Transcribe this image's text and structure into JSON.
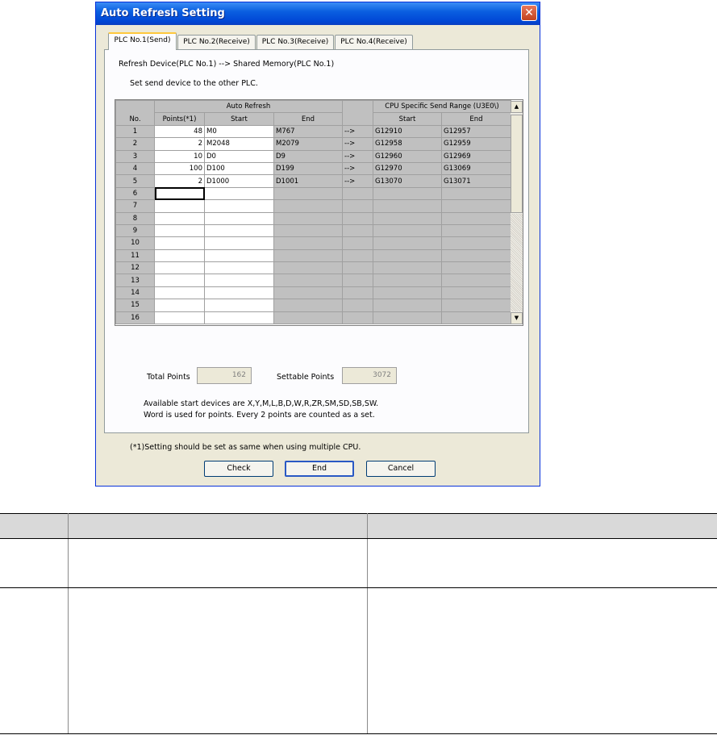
{
  "window": {
    "title": "Auto Refresh Setting",
    "close_glyph": "✕"
  },
  "tabs": [
    {
      "label": "PLC No.1(Send)",
      "active": true
    },
    {
      "label": "PLC No.2(Receive)",
      "active": false
    },
    {
      "label": "PLC No.3(Receive)",
      "active": false
    },
    {
      "label": "PLC No.4(Receive)",
      "active": false
    }
  ],
  "info": {
    "refresh_device": "Refresh Device(PLC No.1) --> Shared Memory(PLC No.1)",
    "instruction": "Set send device to the other PLC."
  },
  "grid": {
    "header_auto_refresh": "Auto Refresh",
    "header_cpu_range": "CPU Specific Send Range (U3E0\\)",
    "col_no": "No.",
    "col_points": "Points(*1)",
    "col_start": "Start",
    "col_end": "End",
    "col_cpu_start": "Start",
    "col_cpu_end": "End",
    "arrow": "-->",
    "rows": [
      {
        "no": "1",
        "points": "48",
        "start": "M0",
        "end": "M767",
        "arrow": "-->",
        "cpu_start": "G12910",
        "cpu_end": "G12957"
      },
      {
        "no": "2",
        "points": "2",
        "start": "M2048",
        "end": "M2079",
        "arrow": "-->",
        "cpu_start": "G12958",
        "cpu_end": "G12959"
      },
      {
        "no": "3",
        "points": "10",
        "start": "D0",
        "end": "D9",
        "arrow": "-->",
        "cpu_start": "G12960",
        "cpu_end": "G12969"
      },
      {
        "no": "4",
        "points": "100",
        "start": "D100",
        "end": "D199",
        "arrow": "-->",
        "cpu_start": "G12970",
        "cpu_end": "G13069"
      },
      {
        "no": "5",
        "points": "2",
        "start": "D1000",
        "end": "D1001",
        "arrow": "-->",
        "cpu_start": "G13070",
        "cpu_end": "G13071"
      },
      {
        "no": "6",
        "points": "",
        "start": "",
        "end": "",
        "arrow": "",
        "cpu_start": "",
        "cpu_end": ""
      },
      {
        "no": "7",
        "points": "",
        "start": "",
        "end": "",
        "arrow": "",
        "cpu_start": "",
        "cpu_end": ""
      },
      {
        "no": "8",
        "points": "",
        "start": "",
        "end": "",
        "arrow": "",
        "cpu_start": "",
        "cpu_end": ""
      },
      {
        "no": "9",
        "points": "",
        "start": "",
        "end": "",
        "arrow": "",
        "cpu_start": "",
        "cpu_end": ""
      },
      {
        "no": "10",
        "points": "",
        "start": "",
        "end": "",
        "arrow": "",
        "cpu_start": "",
        "cpu_end": ""
      },
      {
        "no": "11",
        "points": "",
        "start": "",
        "end": "",
        "arrow": "",
        "cpu_start": "",
        "cpu_end": ""
      },
      {
        "no": "12",
        "points": "",
        "start": "",
        "end": "",
        "arrow": "",
        "cpu_start": "",
        "cpu_end": ""
      },
      {
        "no": "13",
        "points": "",
        "start": "",
        "end": "",
        "arrow": "",
        "cpu_start": "",
        "cpu_end": ""
      },
      {
        "no": "14",
        "points": "",
        "start": "",
        "end": "",
        "arrow": "",
        "cpu_start": "",
        "cpu_end": ""
      },
      {
        "no": "15",
        "points": "",
        "start": "",
        "end": "",
        "arrow": "",
        "cpu_start": "",
        "cpu_end": ""
      },
      {
        "no": "16",
        "points": "",
        "start": "",
        "end": "",
        "arrow": "",
        "cpu_start": "",
        "cpu_end": ""
      }
    ],
    "scroll_up_glyph": "▲",
    "scroll_down_glyph": "▼"
  },
  "totals": {
    "total_points_label": "Total Points",
    "total_points_value": "162",
    "settable_points_label": "Settable Points",
    "settable_points_value": "3072"
  },
  "notes": {
    "line1": "Available start devices are X,Y,M,L,B,D,W,R,ZR,SM,SD,SB,SW.",
    "line2": "Word is used for points. Every 2 points are counted as a set.",
    "footnote": "(*1)Setting should be set as same when using multiple CPU."
  },
  "buttons": {
    "check": "Check",
    "end": "End",
    "cancel": "Cancel"
  },
  "colors": {
    "titlebar": "#0a5fe0",
    "dialog_bg": "#ece9d8",
    "grid_gray": "#c0c0c0",
    "table_header": "#d9d9d9"
  }
}
